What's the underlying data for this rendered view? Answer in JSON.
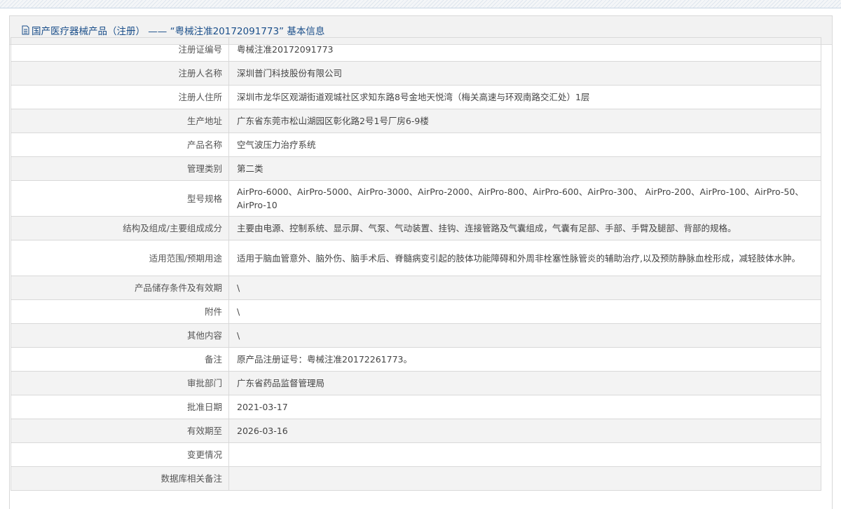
{
  "header": {
    "title": "国产医疗器械产品（注册） —— “粤械注准20172091773” 基本信息"
  },
  "rows": [
    {
      "label": "注册证编号",
      "value": "粤械注准20172091773"
    },
    {
      "label": "注册人名称",
      "value": "深圳普门科技股份有限公司"
    },
    {
      "label": "注册人住所",
      "value": "深圳市龙华区观湖街道观城社区求知东路8号金地天悦湾（梅关高速与环观南路交汇处）1层"
    },
    {
      "label": "生产地址",
      "value": "广东省东莞市松山湖园区彰化路2号1号厂房6-9楼"
    },
    {
      "label": "产品名称",
      "value": "空气波压力治疗系统"
    },
    {
      "label": "管理类别",
      "value": "第二类"
    },
    {
      "label": "型号规格",
      "value": "AirPro-6000、AirPro-5000、AirPro-3000、AirPro-2000、AirPro-800、AirPro-600、AirPro-300、 AirPro-200、AirPro-100、AirPro-50、AirPro-10"
    },
    {
      "label": "结构及组成/主要组成成分",
      "value": "主要由电源、控制系统、显示屏、气泵、气动装置、挂钩、连接管路及气囊组成，气囊有足部、手部、手臂及腿部、背部的规格。"
    },
    {
      "label": "适用范围/预期用途",
      "value": "适用于脑血管意外、脑外伤、脑手术后、脊髓病变引起的肢体功能障碍和外周非栓塞性脉管炎的辅助治疗,以及预防静脉血栓形成，减轻肢体水肿。"
    },
    {
      "label": "产品储存条件及有效期",
      "value": "\\"
    },
    {
      "label": "附件",
      "value": "\\"
    },
    {
      "label": "其他内容",
      "value": "\\"
    },
    {
      "label": "备注",
      "value": "原产品注册证号：粤械注准20172261773。"
    },
    {
      "label": "审批部门",
      "value": "广东省药品监督管理局"
    },
    {
      "label": "批准日期",
      "value": "2021-03-17"
    },
    {
      "label": "有效期至",
      "value": "2026-03-16"
    },
    {
      "label": "变更情况",
      "value": ""
    },
    {
      "label": "数据库相关备注",
      "value": ""
    }
  ]
}
